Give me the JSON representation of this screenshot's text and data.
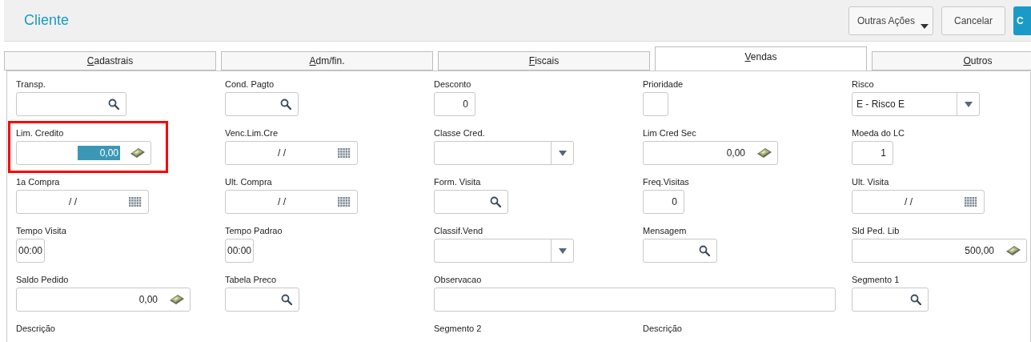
{
  "header": {
    "title": "Cliente",
    "buttons": [
      {
        "label": "Outras Ações",
        "kind": "menu"
      },
      {
        "label": "Cancelar",
        "kind": "plain"
      },
      {
        "label": "C",
        "kind": "primary"
      }
    ]
  },
  "tabs": [
    {
      "label": "Cadastrais",
      "selected": false
    },
    {
      "label": "Adm/fin.",
      "selected": false
    },
    {
      "label": "Fiscais",
      "selected": false
    },
    {
      "label": "Vendas",
      "selected": true
    },
    {
      "label": "Outros",
      "selected": false
    }
  ],
  "rows": [
    [
      {
        "label": "Transp.",
        "kind": "lookup"
      },
      {
        "label": "Cond. Pagto",
        "kind": "lookup"
      },
      {
        "label": "Desconto",
        "kind": "number",
        "value": "0"
      },
      {
        "label": "Prioridade",
        "kind": "text"
      },
      {
        "label": "Risco",
        "kind": "select",
        "value": "E - Risco E"
      }
    ],
    [
      {
        "label": "Lim. Credito",
        "kind": "money",
        "value": "0,00",
        "highlighted": true,
        "outlined": true
      },
      {
        "label": "Venc.Lim.Cre",
        "kind": "date",
        "value": "/ /"
      },
      {
        "label": "Classe Cred.",
        "kind": "select"
      },
      {
        "label": "Lim Cred Sec",
        "kind": "money",
        "value": "0,00"
      },
      {
        "label": "Moeda do LC",
        "kind": "number",
        "value": "1"
      }
    ],
    [
      {
        "label": "1a Compra",
        "kind": "date",
        "value": "/ /"
      },
      {
        "label": "Ult. Compra",
        "kind": "date",
        "value": "/ /"
      },
      {
        "label": "Form. Visita",
        "kind": "lookup"
      },
      {
        "label": "Freq.Visitas",
        "kind": "number",
        "value": "0"
      },
      {
        "label": "Ult. Visita",
        "kind": "date",
        "value": "/ /"
      }
    ],
    [
      {
        "label": "Tempo Visita",
        "kind": "time",
        "value": "00:00"
      },
      {
        "label": "Tempo Padrao",
        "kind": "time",
        "value": "00:00"
      },
      {
        "label": "Classif.Vend",
        "kind": "select"
      },
      {
        "label": "Mensagem",
        "kind": "lookup"
      },
      {
        "label": "Sld Ped. Lib",
        "kind": "money",
        "value": "500,00"
      }
    ],
    [
      {
        "label": "Saldo Pedido",
        "kind": "money",
        "value": "0,00"
      },
      {
        "label": "Tabela Preco",
        "kind": "lookup"
      },
      {
        "label": "Observacao",
        "kind": "wide"
      },
      {
        "label": "Segmento 1",
        "kind": "lookup"
      }
    ],
    [
      {
        "label": "Descrição",
        "kind": "label"
      },
      {
        "kind": "gap"
      },
      {
        "label": "Segmento 2",
        "kind": "label"
      },
      {
        "label": "Descrição",
        "kind": "label"
      }
    ]
  ]
}
